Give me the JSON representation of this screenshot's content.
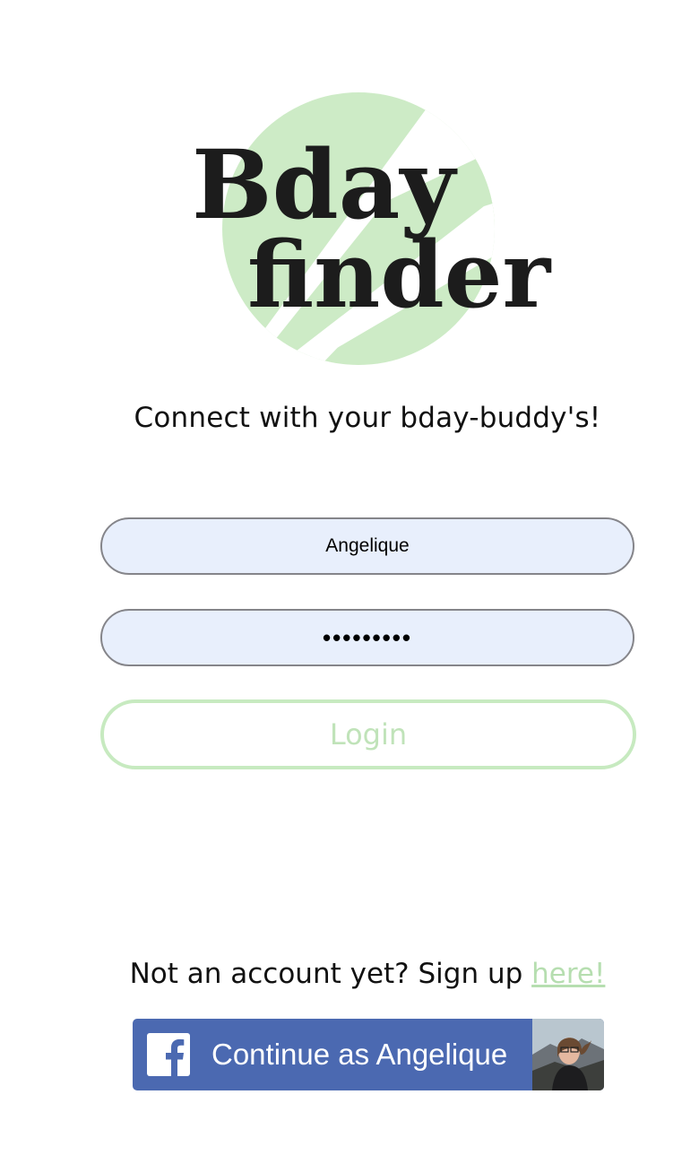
{
  "logo": {
    "line1": "Bday",
    "line2": "finder",
    "circle_color": "#cdebc6",
    "text_color": "#1c1c1c"
  },
  "tagline": "Connect with your bday-buddy's!",
  "login_form": {
    "username_value": "Angelique",
    "password_value": "•••••••••",
    "login_label": "Login"
  },
  "signup": {
    "prompt": "Not an account yet? Sign up ",
    "link_label": "here!"
  },
  "facebook": {
    "label": "Continue as Angelique",
    "logo_icon": "facebook-f-icon",
    "color": "#4b69b1"
  },
  "colors": {
    "accent_green": "#c7eac0",
    "field_bg": "#e8effc"
  }
}
